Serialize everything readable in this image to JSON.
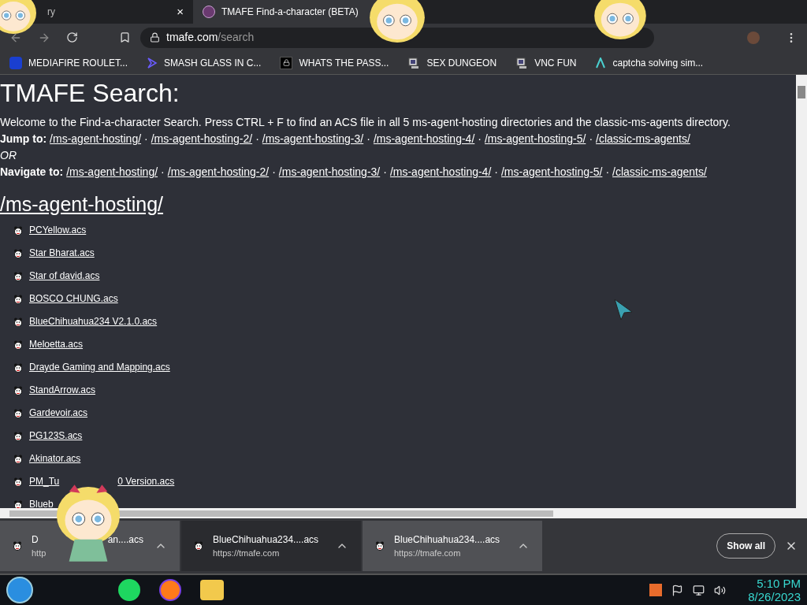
{
  "tabs": [
    {
      "title": "ry",
      "selected": false,
      "close": "×"
    },
    {
      "title": "TMAFE Find-a-character (BETA)",
      "selected": true
    }
  ],
  "address": {
    "host": "tmafe.com",
    "path": "/search"
  },
  "bookmarks": [
    {
      "label": "MEDIAFIRE ROULET...",
      "kind": "mf"
    },
    {
      "label": "SMASH GLASS IN C...",
      "kind": "chevron"
    },
    {
      "label": "WHATS THE PASS...",
      "kind": "lock"
    },
    {
      "label": "SEX DUNGEON",
      "kind": "agent"
    },
    {
      "label": "VNC FUN",
      "kind": "agent"
    },
    {
      "label": "captcha solving sim...",
      "kind": "lambda"
    }
  ],
  "page": {
    "title": "TMAFE Search:",
    "intro": "Welcome to the Find-a-character Search. Press CTRL + F to find an ACS file in all 5 ms-agent-hosting directories and the classic-ms-agents directory.",
    "jump": {
      "label": "Jump to:",
      "separator": "·",
      "links": [
        "/ms-agent-hosting/",
        "/ms-agent-hosting-2/",
        "/ms-agent-hosting-3/",
        "/ms-agent-hosting-4/",
        "/ms-agent-hosting-5/",
        "/classic-ms-agents/"
      ]
    },
    "or": "OR",
    "navigate": {
      "label": "Navigate to:",
      "separator": "·",
      "links": [
        "/ms-agent-hosting/",
        "/ms-agent-hosting-2/",
        "/ms-agent-hosting-3/",
        "/ms-agent-hosting-4/",
        "/ms-agent-hosting-5/",
        "/classic-ms-agents/"
      ]
    },
    "section": "/ms-agent-hosting/",
    "files": [
      {
        "segments": [
          "PCYellow.acs"
        ]
      },
      {
        "segments": [
          "Star Bharat.acs"
        ]
      },
      {
        "segments": [
          "Star of david.acs"
        ]
      },
      {
        "segments": [
          "BOSCO CHUNG.acs"
        ]
      },
      {
        "segments": [
          "BlueChihuahua234 V2.1.0.acs"
        ]
      },
      {
        "segments": [
          "Meloetta.acs"
        ]
      },
      {
        "segments": [
          "Drayde Gaming and Mapping.acs"
        ]
      },
      {
        "segments": [
          "StandArrow.acs"
        ]
      },
      {
        "segments": [
          "Gardevoir.acs"
        ]
      },
      {
        "segments": [
          "PG123S.acs"
        ]
      },
      {
        "segments": [
          "Akinator.acs"
        ]
      },
      {
        "segments": [
          "PM_Tu",
          "0 Version.acs"
        ]
      },
      {
        "segments": [
          "Blueb"
        ]
      }
    ]
  },
  "downloads": [
    {
      "name": [
        "D",
        "an....acs"
      ],
      "url": "http"
    },
    {
      "name": [
        "BlueChihuahua234....acs"
      ],
      "url": "https://tmafe.com"
    },
    {
      "name": [
        "BlueChihuahua234....acs"
      ],
      "url": "https://tmafe.com"
    }
  ],
  "show_all": "Show all",
  "clock": {
    "time": "5:10 PM",
    "date": "8/26/2023"
  }
}
